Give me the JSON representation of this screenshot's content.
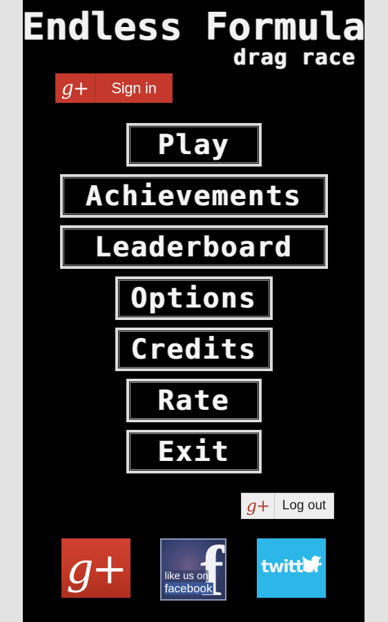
{
  "app": {
    "title": "Endless Formula",
    "subtitle": "drag race",
    "background_color": "#000000",
    "frame_color": "#e3e3e3"
  },
  "auth": {
    "signin": {
      "label": "Sign in",
      "icon": "google-plus-icon",
      "icon_glyph": "g+",
      "background_color": "#c4392c",
      "text_color": "#ffffff"
    },
    "logout": {
      "label": "Log out",
      "icon": "google-plus-icon",
      "icon_glyph": "g+",
      "background_color": "#eeeeee",
      "text_color": "#1d1d1d"
    }
  },
  "menu": {
    "items": [
      {
        "label": "Play",
        "width_class": "w-narrow"
      },
      {
        "label": "Achievements",
        "width_class": "w-wide"
      },
      {
        "label": "Leaderboard",
        "width_class": "w-wide"
      },
      {
        "label": "Options",
        "width_class": "w-medium"
      },
      {
        "label": "Credits",
        "width_class": "w-medium"
      },
      {
        "label": "Rate",
        "width_class": "w-narrow"
      },
      {
        "label": "Exit",
        "width_class": "w-narrow"
      }
    ]
  },
  "social": {
    "google_plus": {
      "name": "google-plus-icon",
      "glyph": "g+",
      "color": "#c33826"
    },
    "facebook": {
      "name": "facebook-icon",
      "glyph": "f",
      "line1": "like us on",
      "line2": "facebook",
      "color": "#3b5998"
    },
    "twitter": {
      "name": "twitter-icon",
      "word": "twitter",
      "color": "#2db7e8"
    }
  }
}
